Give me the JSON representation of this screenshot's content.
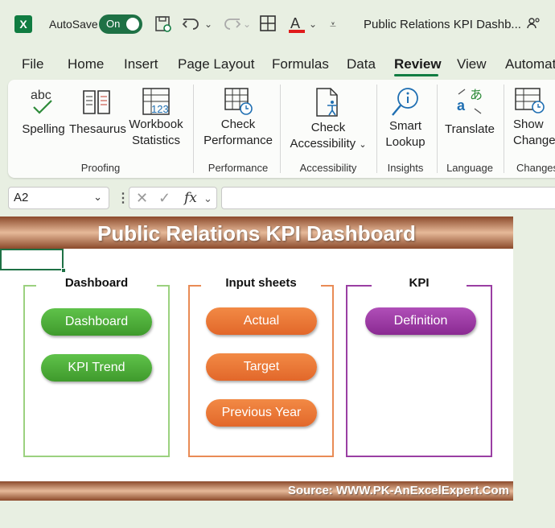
{
  "titlebar": {
    "autosave_label": "AutoSave",
    "toggle_label": "On",
    "doc_title": "Public Relations KPI Dashb..."
  },
  "tabs": [
    "File",
    "Home",
    "Insert",
    "Page Layout",
    "Formulas",
    "Data",
    "Review",
    "View",
    "Automat"
  ],
  "active_tab": "Review",
  "ribbon": {
    "spelling": "Spelling",
    "thesaurus": "Thesaurus",
    "workbook_statistics_1": "Workbook",
    "workbook_statistics_2": "Statistics",
    "check_performance_1": "Check",
    "check_performance_2": "Performance",
    "check_accessibility_1": "Check",
    "check_accessibility_2": "Accessibility",
    "smart_lookup_1": "Smart",
    "smart_lookup_2": "Lookup",
    "translate": "Translate",
    "show_changes_1": "Show",
    "show_changes_2": "Changes",
    "groups": {
      "proofing": "Proofing",
      "performance": "Performance",
      "accessibility": "Accessibility",
      "insights": "Insights",
      "language": "Language",
      "changes": "Changes"
    }
  },
  "formula_bar": {
    "name_box": "A2",
    "fx": "fx",
    "formula": ""
  },
  "sheet": {
    "title": "Public Relations KPI Dashboard",
    "footer": "Source: WWW.PK-AnExcelExpert.Com",
    "panels": {
      "dashboard": {
        "title": "Dashboard",
        "buttons": [
          "Dashboard",
          "KPI Trend"
        ],
        "color": "#9bd17f"
      },
      "input": {
        "title": "Input sheets",
        "buttons": [
          "Actual",
          "Target",
          "Previous Year"
        ],
        "color": "#e98b55"
      },
      "kpi": {
        "title": "KPI",
        "buttons": [
          "Definition"
        ],
        "color": "#9a3fa3"
      }
    }
  },
  "colors": {
    "excel_green": "#107c41",
    "header_brown": "#8b4a2b"
  }
}
